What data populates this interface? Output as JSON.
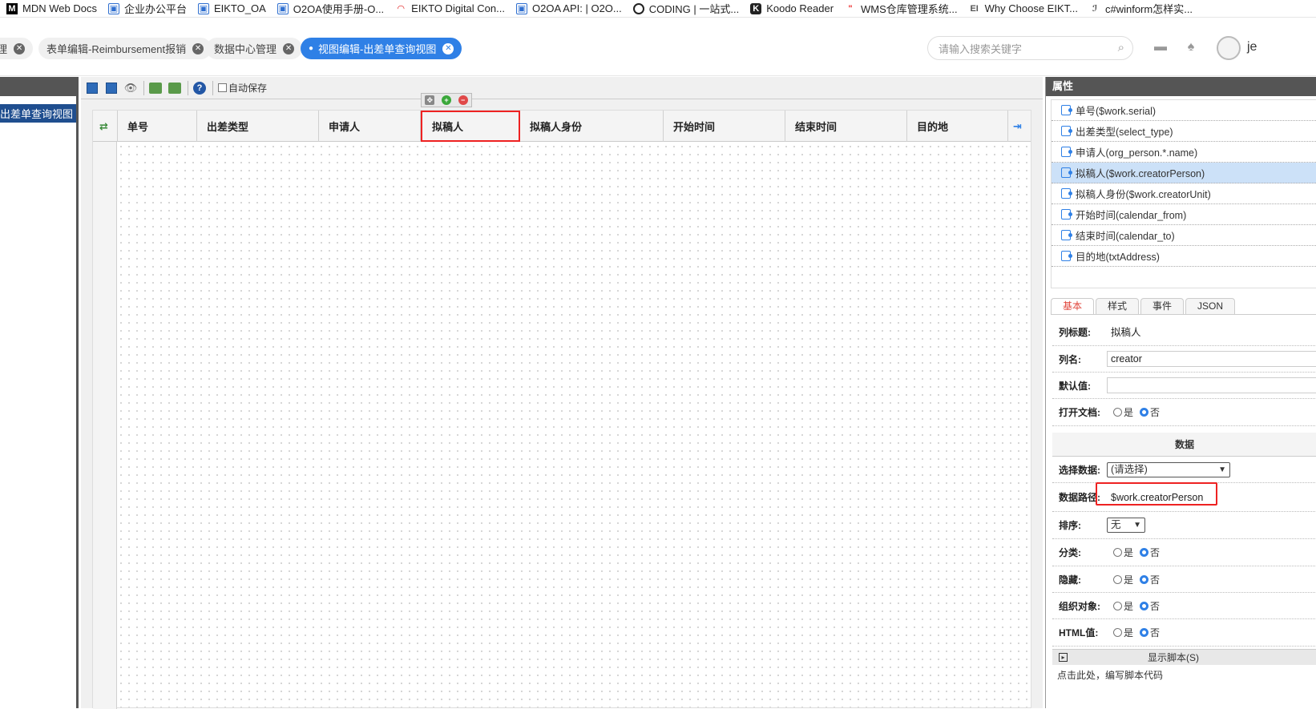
{
  "bookmarks": [
    {
      "icon": "mdn-icon",
      "label": "MDN Web Docs"
    },
    {
      "icon": "doc-icon",
      "label": "企业办公平台"
    },
    {
      "icon": "doc-icon",
      "label": "EIKTO_OA"
    },
    {
      "icon": "doc-icon",
      "label": "O2OA使用手册-O..."
    },
    {
      "icon": "arc-icon",
      "label": "EIKTO Digital Con..."
    },
    {
      "icon": "doc-icon",
      "label": "O2OA API: | O2O..."
    },
    {
      "icon": "coding-icon",
      "label": "CODING | 一站式..."
    },
    {
      "icon": "koodo-icon",
      "label": "Koodo Reader"
    },
    {
      "icon": "wms-icon",
      "label": "WMS仓库管理系统..."
    },
    {
      "icon": "why-icon",
      "label": "Why Choose EIKT..."
    },
    {
      "icon": "cs-icon",
      "label": "c#winform怎样实..."
    }
  ],
  "tabs": [
    {
      "label": "理",
      "active": false
    },
    {
      "label": "表单编辑-Reimbursement报销",
      "active": false
    },
    {
      "label": "数据中心管理",
      "active": false
    },
    {
      "label": "视图编辑-出差单查询视图",
      "active": true
    }
  ],
  "search": {
    "placeholder": "请输入搜索关键字"
  },
  "user": {
    "name_fragment": "je"
  },
  "left_panel": {
    "selected_item": "出差单查询视图"
  },
  "toolbar": {
    "autosave_label": "自动保存",
    "autosave_checked": false
  },
  "columns": [
    {
      "label": "单号"
    },
    {
      "label": "出差类型"
    },
    {
      "label": "申请人"
    },
    {
      "label": "拟稿人"
    },
    {
      "label": "拟稿人身份"
    },
    {
      "label": "开始时间"
    },
    {
      "label": "结束时间"
    },
    {
      "label": "目的地"
    }
  ],
  "selected_column": "拟稿人",
  "properties_panel": {
    "title": "属性",
    "items": [
      "单号($work.serial)",
      "出差类型(select_type)",
      "申请人(org_person.*.name)",
      "拟稿人($work.creatorPerson)",
      "拟稿人身份($work.creatorUnit)",
      "开始时间(calendar_from)",
      "结束时间(calendar_to)",
      "目的地(txtAddress)"
    ],
    "selected_index": 3,
    "tabs": [
      "基本",
      "样式",
      "事件",
      "JSON"
    ],
    "active_tab": "基本",
    "fields": {
      "column_title_label": "列标题:",
      "column_title_value": "拟稿人",
      "column_name_label": "列名:",
      "column_name_value": "creator",
      "default_label": "默认值:",
      "default_value": "",
      "open_doc_label": "打开文档:",
      "yes": "是",
      "no": "否",
      "data_section": "数据",
      "select_data_label": "选择数据:",
      "select_data_value": "(请选择)",
      "data_path_label": "数据路径:",
      "data_path_value": "$work.creatorPerson",
      "sort_label": "排序:",
      "sort_value": "无",
      "group_label": "分类:",
      "hidden_label": "隐藏:",
      "org_label": "组织对象:",
      "html_label": "HTML值:"
    },
    "script_bar_label": "显示脚本(S)",
    "script_hint": "点击此处，编写脚本代码"
  }
}
